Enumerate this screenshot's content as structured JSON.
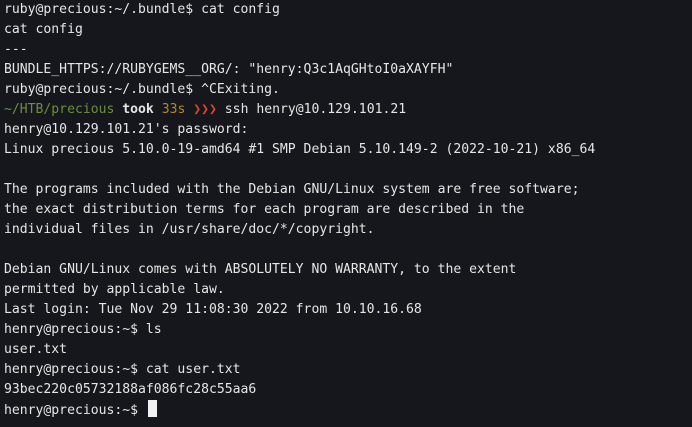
{
  "terminal": {
    "lines": [
      "ruby@precious:~/.bundle$ cat config",
      "cat config",
      "---",
      "BUNDLE_HTTPS://RUBYGEMS__ORG/: \"henry:Q3c1AqGHtoI0aXAYFH\"",
      "ruby@precious:~/.bundle$ ^CExiting."
    ],
    "prompt": {
      "path": "~/HTB/precious",
      "took_label": "took",
      "duration": "33s",
      "arrows": "❯❯❯",
      "command": "ssh henry@10.129.101.21"
    },
    "output_lines": [
      "henry@10.129.101.21's password:",
      "Linux precious 5.10.0-19-amd64 #1 SMP Debian 5.10.149-2 (2022-10-21) x86_64",
      "",
      "The programs included with the Debian GNU/Linux system are free software;",
      "the exact distribution terms for each program are described in the",
      "individual files in /usr/share/doc/*/copyright.",
      "",
      "Debian GNU/Linux comes with ABSOLUTELY NO WARRANTY, to the extent",
      "permitted by applicable law.",
      "Last login: Tue Nov 29 11:08:30 2022 from 10.10.16.68",
      "henry@precious:~$ ls",
      "user.txt",
      "henry@precious:~$ cat user.txt",
      "93bec220c05732188af086fc28c55aa6"
    ],
    "final_prompt": "henry@precious:~$ ",
    "colors": {
      "background": "#15171c",
      "text": "#e6e6e6",
      "path": "#6b8f3e",
      "duration": "#b8862d",
      "arrows": "#e0452b"
    }
  }
}
